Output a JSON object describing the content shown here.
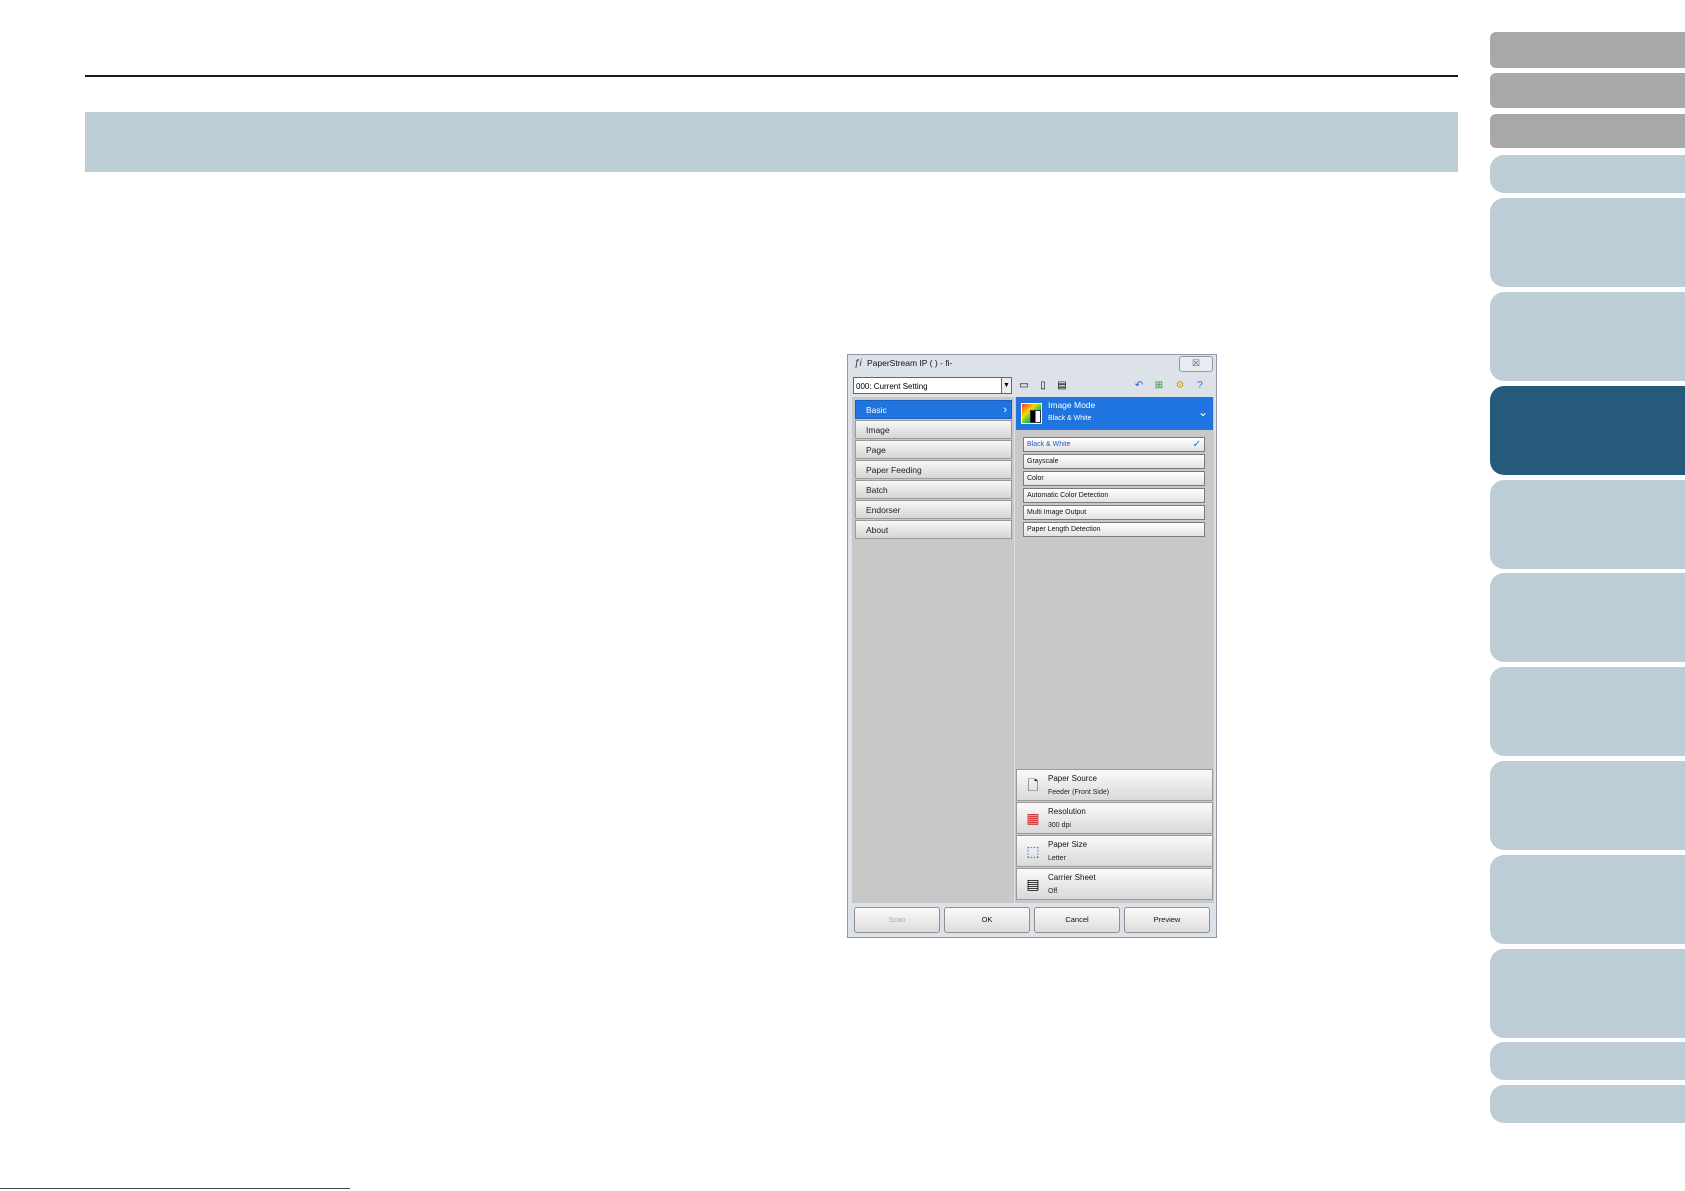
{
  "dialog": {
    "title": "PaperStream IP (       ) - fi-    ",
    "close_glyph": "☒",
    "setting_value": "000: Current Setting",
    "toolbar_icons": [
      "save-icon",
      "save-as-icon",
      "export-icon",
      "undo-icon",
      "default-settings-icon",
      "settings-icon",
      "help-icon"
    ],
    "nav_items": [
      {
        "label": "Basic",
        "selected": true
      },
      {
        "label": "Image",
        "selected": false
      },
      {
        "label": "Page",
        "selected": false
      },
      {
        "label": "Paper Feeding",
        "selected": false
      },
      {
        "label": "Batch",
        "selected": false
      },
      {
        "label": "Endorser",
        "selected": false
      },
      {
        "label": "About",
        "selected": false
      }
    ],
    "image_mode": {
      "name": "Image Mode",
      "value": "Black & White",
      "options": [
        {
          "label": "Black & White",
          "selected": true
        },
        {
          "label": "Grayscale",
          "selected": false
        },
        {
          "label": "Color",
          "selected": false
        },
        {
          "label": "Automatic Color Detection",
          "selected": false
        },
        {
          "label": "Multi Image Output",
          "selected": false
        },
        {
          "label": "Paper Length Detection",
          "selected": false
        }
      ]
    },
    "settings": [
      {
        "name": "Paper Source",
        "value": "Feeder (Front Side)",
        "icon": "paper-source-icon"
      },
      {
        "name": "Resolution",
        "value": "300 dpi",
        "icon": "resolution-icon"
      },
      {
        "name": "Paper Size",
        "value": "Letter",
        "icon": "paper-size-icon"
      },
      {
        "name": "Carrier Sheet",
        "value": "Off",
        "icon": "carrier-sheet-icon"
      }
    ],
    "buttons": {
      "scan": "Scan",
      "ok": "OK",
      "cancel": "Cancel",
      "preview": "Preview"
    }
  },
  "colors": {
    "accent": "#1f74e0",
    "active_tab": "#265a7a",
    "tab": "#bccdd6",
    "gray_tab": "#a8a8a8"
  }
}
